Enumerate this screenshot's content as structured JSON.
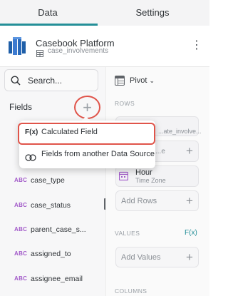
{
  "tabs": {
    "data": "Data",
    "settings": "Settings"
  },
  "source": {
    "name": "Casebook Platform",
    "table": "case_involvements",
    "menu_icon": "⋮"
  },
  "search": {
    "placeholder": "Search..."
  },
  "fields": {
    "label": "Fields",
    "add_icon": "+",
    "items": [
      {
        "type": "ABC",
        "name": "case_type"
      },
      {
        "type": "ABC",
        "name": "case_status"
      },
      {
        "type": "ABC",
        "name": "parent_case_s..."
      },
      {
        "type": "ABC",
        "name": "assigned_to"
      },
      {
        "type": "ABC",
        "name": "assignee_email"
      }
    ]
  },
  "popup": {
    "items": [
      {
        "icon": "F(x)",
        "label": "Calculated Field"
      },
      {
        "icon": "link-icon",
        "label": "Fields from another Data Source"
      }
    ]
  },
  "pivot": {
    "mode": "Pivot",
    "rows_label": "ROWS",
    "row_field_1": "...ate_involve...",
    "row_field_2": "...e",
    "time_field_title": "Hour",
    "time_field_sub": "Time Zone",
    "add_rows": "Add Rows",
    "values_label": "VALUES",
    "values_fx": "F(x)",
    "add_values": "Add Values",
    "columns_label": "COLUMNS",
    "plus": "+"
  },
  "colors": {
    "accent": "#248f98",
    "annotation_red": "#e0544a",
    "field_type": "#a25ac9"
  }
}
